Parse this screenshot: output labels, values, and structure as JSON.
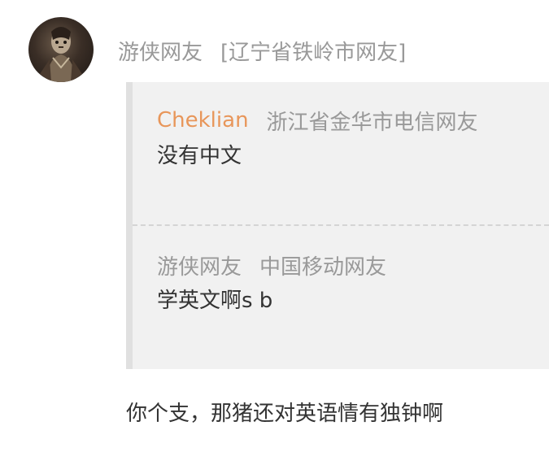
{
  "comment": {
    "avatar_icon": "user-avatar-icon",
    "username": "游侠网友",
    "location": "[辽宁省铁岭市网友]"
  },
  "quote": {
    "items": [
      {
        "username": "Cheklian",
        "location": "浙江省金华市电信网友",
        "text": "没有中文"
      },
      {
        "username": "游侠网友",
        "location": "中国移动网友",
        "text": "学英文啊s b"
      }
    ]
  },
  "reply": {
    "text": "你个支，那猪还对英语情有独钟啊"
  },
  "colors": {
    "quote_username_accent": "#e8965a",
    "meta_gray": "#999999",
    "body_text": "#333333",
    "quote_background": "#f1f1f1"
  }
}
